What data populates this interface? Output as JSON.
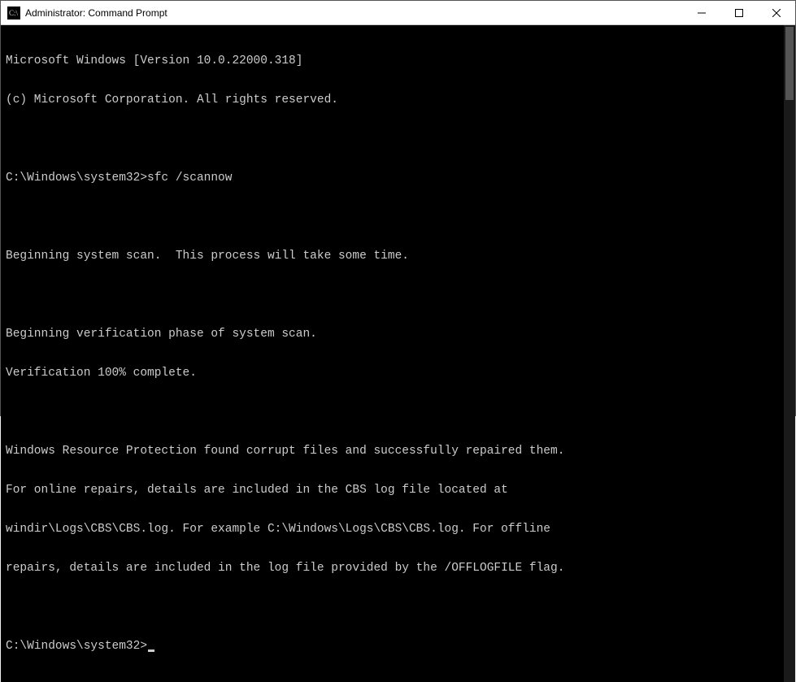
{
  "window": {
    "title": "Administrator: Command Prompt"
  },
  "terminal": {
    "lines": [
      "Microsoft Windows [Version 10.0.22000.318]",
      "(c) Microsoft Corporation. All rights reserved.",
      "",
      "",
      "",
      "Beginning system scan.  This process will take some time.",
      "",
      "Beginning verification phase of system scan.",
      "Verification 100% complete.",
      "",
      "Windows Resource Protection found corrupt files and successfully repaired them.",
      "For online repairs, details are included in the CBS log file located at",
      "windir\\Logs\\CBS\\CBS.log. For example C:\\Windows\\Logs\\CBS\\CBS.log. For offline",
      "repairs, details are included in the log file provided by the /OFFLOGFILE flag.",
      ""
    ],
    "first_prompt": {
      "path": "C:\\Windows\\system32>",
      "command": "sfc /scannow"
    },
    "current_prompt": {
      "path": "C:\\Windows\\system32>",
      "command": ""
    }
  },
  "icons": {
    "app": "cmd-icon",
    "minimize": "—",
    "maximize": "□",
    "close": "✕"
  }
}
